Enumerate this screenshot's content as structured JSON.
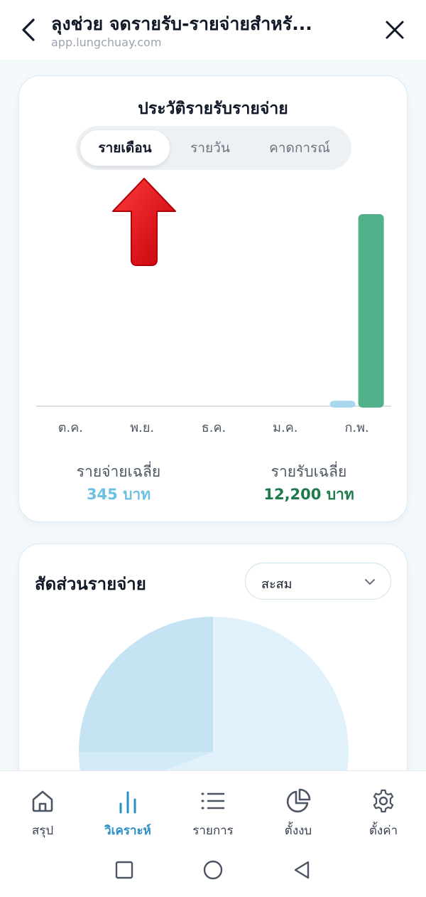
{
  "topbar": {
    "title": "ลุงช่วย จดรายรับ-รายจ่ายสำหรั...",
    "url": "app.lungchuay.com",
    "back_icon": "chevron-left-icon",
    "close_icon": "close-icon"
  },
  "history_card": {
    "title": "ประวัติรายรับรายจ่าย",
    "tabs": [
      {
        "label": "รายเดือน",
        "active": true
      },
      {
        "label": "รายวัน",
        "active": false
      },
      {
        "label": "คาดการณ์",
        "active": false
      }
    ],
    "annotation_icon": "red-arrow-up-icon",
    "chart_data": {
      "type": "bar",
      "categories": [
        "ต.ค.",
        "พ.ย.",
        "ธ.ค.",
        "ม.ค.",
        "ก.พ."
      ],
      "series": [
        {
          "values": [
            0,
            0,
            0,
            0,
            345
          ],
          "color": "#a8d8f0"
        },
        {
          "values": [
            0,
            0,
            0,
            0,
            12200
          ],
          "color": "#52b18a"
        }
      ],
      "ylim": [
        0,
        12200
      ]
    },
    "avg_expense_label": "รายจ่ายเฉลี่ย",
    "avg_expense_value": "345 บาท",
    "avg_income_label": "รายรับเฉลี่ย",
    "avg_income_value": "12,200 บาท",
    "colors": {
      "expense": "#6cc0e3",
      "income": "#1e7a4a"
    }
  },
  "ratio_card": {
    "title": "สัดส่วนรายจ่าย",
    "dropdown_value": "สะสม",
    "dropdown_icon": "chevron-down-icon"
  },
  "bottom_nav": {
    "items": [
      {
        "label": "สรุป",
        "icon": "home-icon",
        "active": false
      },
      {
        "label": "วิเคราะห์",
        "icon": "bar-chart-icon",
        "active": true
      },
      {
        "label": "รายการ",
        "icon": "list-icon",
        "active": false
      },
      {
        "label": "ตั้งงบ",
        "icon": "pie-chart-icon",
        "active": false
      },
      {
        "label": "ตั้งค่า",
        "icon": "gear-icon",
        "active": false
      }
    ],
    "accent": "#2b8fc4"
  },
  "system_nav": {
    "icons": [
      "recent-apps-icon",
      "home-circle-icon",
      "back-triangle-icon"
    ]
  }
}
